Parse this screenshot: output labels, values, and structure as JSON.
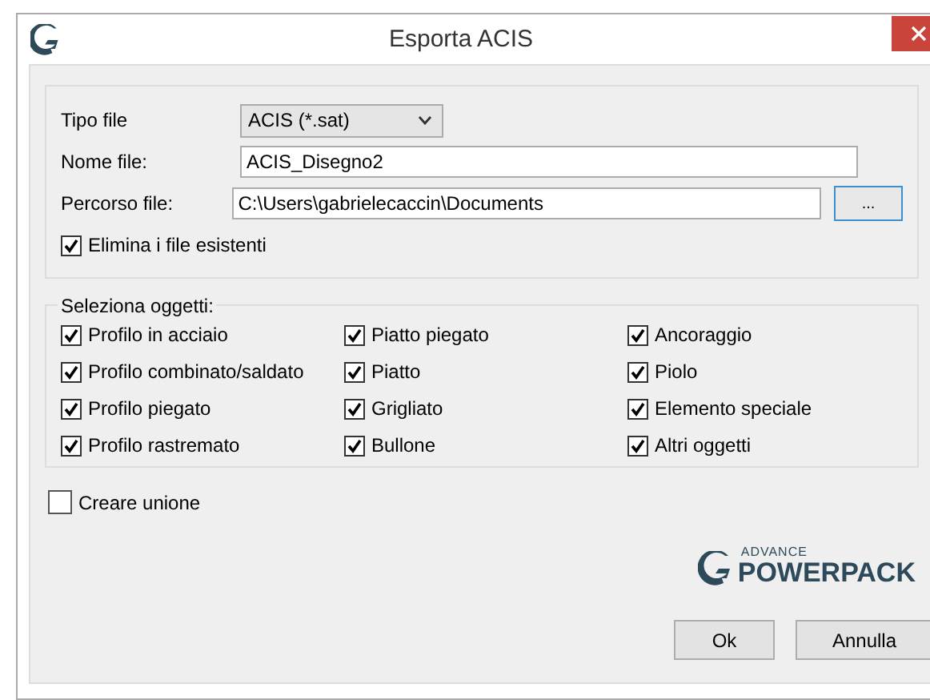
{
  "window": {
    "title": "Esporta ACIS"
  },
  "file": {
    "type_label": "Tipo file",
    "type_value": "ACIS (*.sat)",
    "name_label": "Nome file:",
    "name_value": "ACIS_Disegno2",
    "path_label": "Percorso file:",
    "path_value": "C:\\Users\\gabrielecaccin\\Documents",
    "browse": "...",
    "delete_existing": {
      "label": "Elimina i file esistenti",
      "checked": true
    }
  },
  "objects": {
    "title": "Seleziona oggetti:",
    "items": [
      {
        "label": "Profilo in acciaio",
        "checked": true
      },
      {
        "label": "Piatto piegato",
        "checked": true
      },
      {
        "label": "Ancoraggio",
        "checked": true
      },
      {
        "label": "Profilo combinato/saldato",
        "checked": true
      },
      {
        "label": "Piatto",
        "checked": true
      },
      {
        "label": "Piolo",
        "checked": true
      },
      {
        "label": "Profilo piegato",
        "checked": true
      },
      {
        "label": "Grigliato",
        "checked": true
      },
      {
        "label": "Elemento speciale",
        "checked": true
      },
      {
        "label": "Profilo rastremato",
        "checked": true
      },
      {
        "label": "Bullone",
        "checked": true
      },
      {
        "label": "Altri oggetti",
        "checked": true
      }
    ]
  },
  "create_union": {
    "label": "Creare unione",
    "checked": false
  },
  "logo": {
    "small": "ADVANCE",
    "large": "POWERPACK"
  },
  "buttons": [
    "Ok",
    "Annulla"
  ]
}
